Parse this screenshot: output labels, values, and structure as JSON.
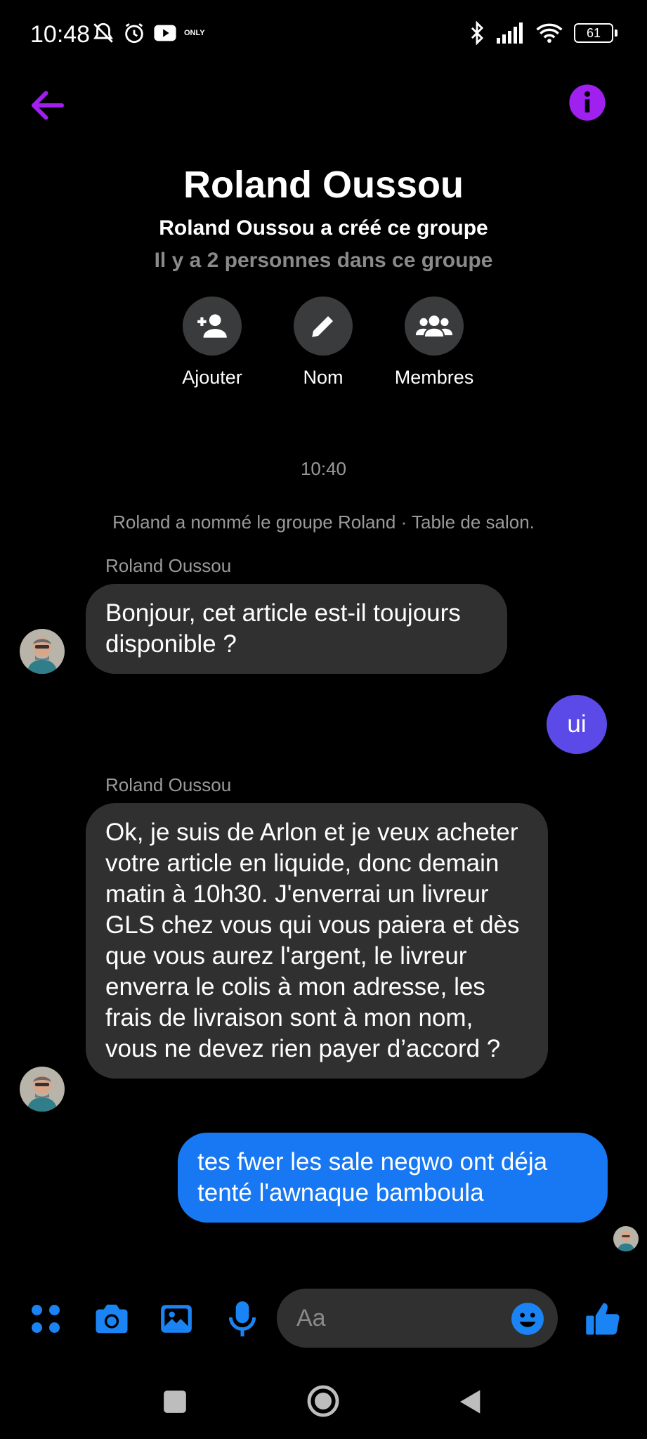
{
  "status_bar": {
    "time": "10:48",
    "only_label": "ONLY",
    "battery": "61"
  },
  "header": {
    "title": "Roland Oussou",
    "creator_text": "Roland Oussou a créé ce groupe",
    "member_count_text": "Il y a 2 personnes dans ce groupe",
    "actions": [
      {
        "label": "Ajouter",
        "icon": "add-person-icon"
      },
      {
        "label": "Nom",
        "icon": "pencil-icon"
      },
      {
        "label": "Membres",
        "icon": "group-icon"
      }
    ]
  },
  "conversation": {
    "timestamp": "10:40",
    "system_message": "Roland a nommé le groupe Roland · Table de salon.",
    "messages": [
      {
        "sender": "Roland Oussou",
        "direction": "incoming",
        "text": "Bonjour, cet article est-il toujours disponible ?"
      },
      {
        "direction": "outgoing",
        "text": "ui"
      },
      {
        "sender": "Roland Oussou",
        "direction": "incoming",
        "text": "Ok, je suis de Arlon et je veux acheter votre article en liquide, donc demain matin à 10h30. J'enverrai un livreur GLS chez vous qui vous paiera et dès que vous aurez l'argent, le livreur enverra le colis à mon adresse, les frais de livraison sont à mon nom, vous ne devez rien payer d’accord ?"
      },
      {
        "direction": "outgoing",
        "text": "tes fwer les sale negwo ont déja tenté l'awnaque bamboula"
      }
    ]
  },
  "composer": {
    "placeholder": "Aa",
    "icons": [
      "apps-icon",
      "camera-icon",
      "gallery-icon",
      "microphone-icon",
      "emoji-icon",
      "thumbs-up-icon"
    ]
  },
  "colors": {
    "accent_purple": "#a020f0",
    "outgoing_blue": "#1877f2",
    "outgoing_purple": "#5b4ae8",
    "icon_blue": "#1b84f5",
    "bubble_gray": "#303030"
  }
}
